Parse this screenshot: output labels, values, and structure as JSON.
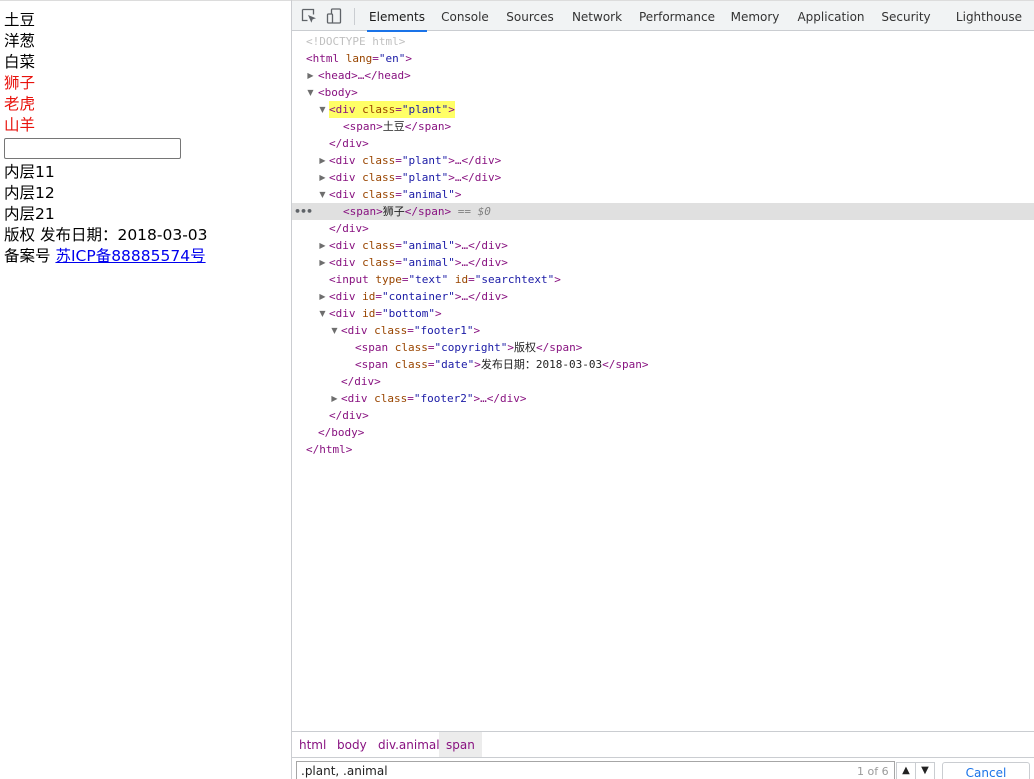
{
  "page": {
    "plants": [
      "土豆",
      "洋葱",
      "白菜"
    ],
    "animals": [
      "狮子",
      "老虎",
      "山羊"
    ],
    "search_value": "",
    "container_items": [
      "内层11",
      "内层12",
      "内层21"
    ],
    "footer": {
      "copyright": "版权",
      "date": "发布日期：2018-03-03",
      "record_label": "备案号",
      "record_link": "苏ICP备88885574号"
    }
  },
  "toolbar": {
    "icons": [
      "inspect-element-icon",
      "device-toggle-icon"
    ],
    "tabs": [
      "Elements",
      "Console",
      "Sources",
      "Network",
      "Performance",
      "Memory",
      "Application",
      "Security",
      "Lighthouse"
    ],
    "active_tab": "Elements"
  },
  "dom": {
    "doctype": "<!DOCTYPE html>",
    "html_open_tag": "<html",
    "html_lang_attr": "lang",
    "html_lang_val": "\"en\"",
    "head": "<head>…</head>",
    "body_open": "<body>",
    "div_open": "<div",
    "class_attr": "class",
    "id_attr": "id",
    "plant_val": "\"plant\"",
    "animal_val": "\"animal\"",
    "collapsed_close": ">…</div>",
    "gt": ">",
    "span_open": "<span>",
    "span_close": "</span>",
    "span_text_1": "土豆",
    "span_text_2": "狮子",
    "dollar_zero": " == $0",
    "div_close": "</div>",
    "input_tag": "<input",
    "type_attr": "type",
    "text_val": "\"text\"",
    "searchtext_val": "\"searchtext\"",
    "container_val": "\"container\"",
    "bottom_val": "\"bottom\"",
    "footer1_val": "\"footer1\"",
    "footer2_val": "\"footer2\"",
    "span_tag": "<span",
    "copyright_val": "\"copyright\"",
    "copyright_text": "版权",
    "date_val": "\"date\"",
    "date_text": "发布日期：2018-03-03",
    "body_close": "</body>",
    "html_close": "</html>"
  },
  "breadcrumb": [
    "html",
    "body",
    "div.animal",
    "span"
  ],
  "search": {
    "query": ".plant, .animal",
    "match_count": "1 of 6",
    "cancel_label": "Cancel"
  },
  "colors": {
    "animal_text": "#e8120c",
    "tag": "#881280",
    "attr_name": "#994500",
    "attr_value": "#1a1aa6",
    "selection_highlight": "#ffff66",
    "active_tab_underline": "#1a73e8"
  }
}
